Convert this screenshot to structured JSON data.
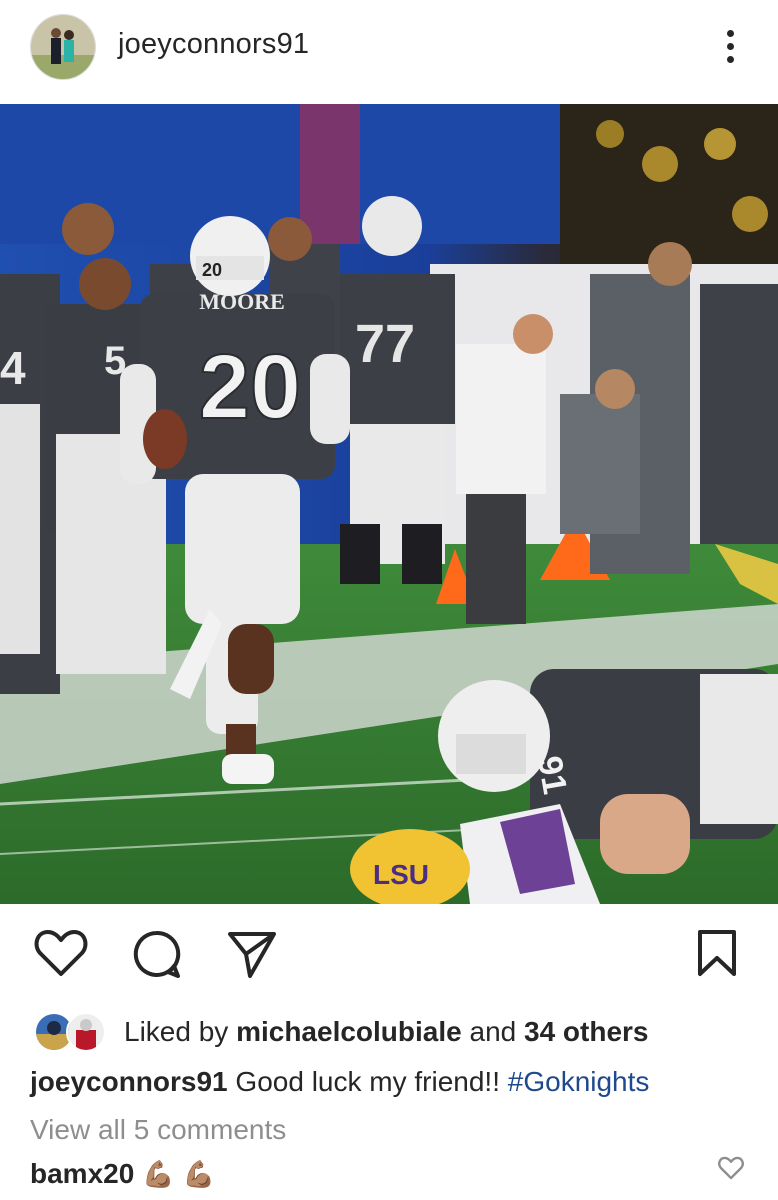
{
  "post": {
    "username": "joeyconnors91",
    "more_icon": "more-vertical-icon"
  },
  "photo": {
    "jerseys": {
      "runner_name": "MOORE",
      "runner_number": "20",
      "lineman_number": "77",
      "left_number": "5",
      "edge_number": "4",
      "tackler_number": "91",
      "helmet_text": "LSU"
    }
  },
  "actions": {
    "like_icon": "heart-icon",
    "comment_icon": "comment-bubble-icon",
    "share_icon": "paper-plane-icon",
    "save_icon": "bookmark-icon"
  },
  "likes": {
    "prefix": "Liked by",
    "user": "michaelcolubiale",
    "conjunction": "and",
    "others": "34 others"
  },
  "caption": {
    "username": "joeyconnors91",
    "text": "Good luck my friend!!",
    "hashtag": "#Goknights"
  },
  "comments": {
    "view_all": "View all 5 comments",
    "top": {
      "username": "bamx20",
      "text": "💪🏽 💪🏽"
    }
  },
  "colors": {
    "text": "#262626",
    "muted": "#8e8e8e",
    "hashtag": "#1e4a8c"
  }
}
